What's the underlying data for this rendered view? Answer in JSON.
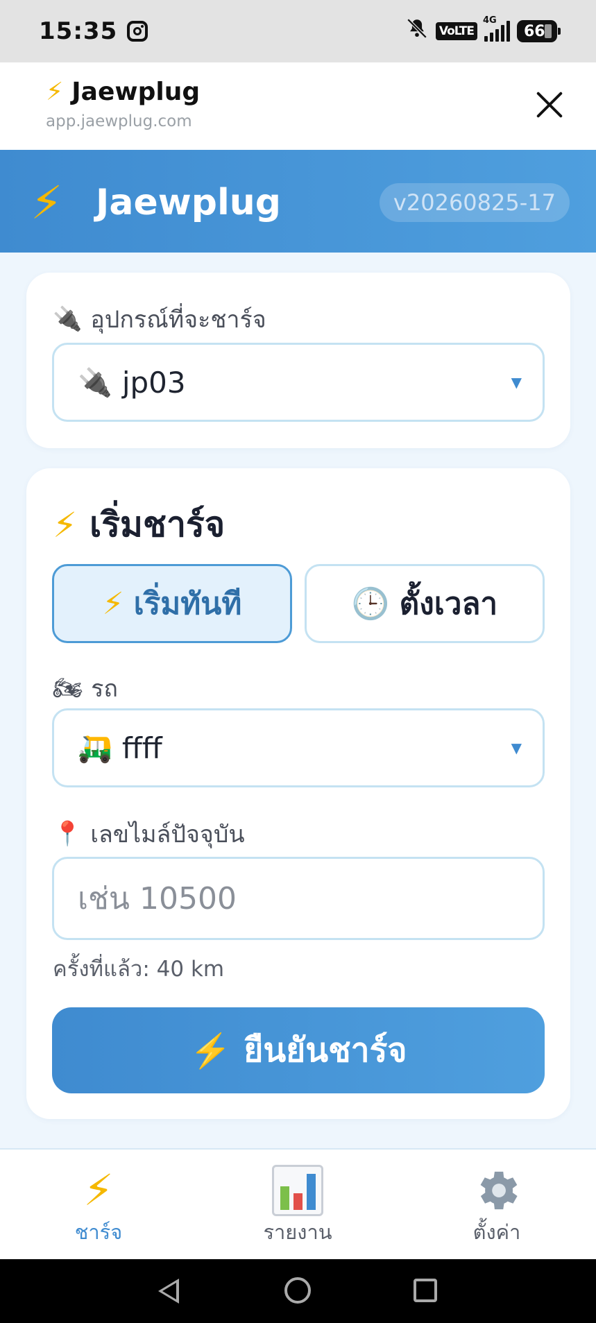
{
  "status_bar": {
    "time": "15:35",
    "network": "4G",
    "volte": "VoLTE",
    "battery": "66"
  },
  "browser": {
    "title": "Jaewplug",
    "url": "app.jaewplug.com"
  },
  "app_header": {
    "title": "Jaewplug",
    "version": "v20260825-17"
  },
  "device_card": {
    "label": "อุปกรณ์ที่จะชาร์จ",
    "selected": "jp03"
  },
  "charge_card": {
    "title": "เริ่มชาร์จ",
    "mode_now": "เริ่มทันที",
    "mode_timer": "ตั้งเวลา",
    "vehicle_label": "รถ",
    "vehicle_selected": "ffff",
    "odometer_label": "เลขไมล์ปัจจุบัน",
    "odometer_placeholder": "เช่น 10500",
    "last_hint": "ครั้งที่แล้ว: 40 km",
    "confirm_label": "ยืนยันชาร์จ"
  },
  "bottom_nav": {
    "charge": "ชาร์จ",
    "report": "รายงาน",
    "settings": "ตั้งค่า"
  },
  "colors": {
    "accent": "#3f8bd0",
    "bolt": "#f5b800",
    "background": "#eef6fd"
  }
}
